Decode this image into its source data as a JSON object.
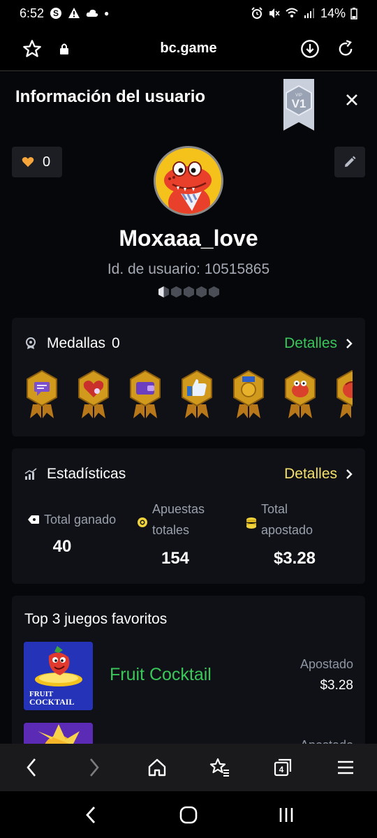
{
  "status_bar": {
    "time": "6:52",
    "battery": "14%"
  },
  "browser": {
    "url": "bc.game",
    "tabs_count": "4"
  },
  "modal": {
    "title": "Información del usuario",
    "vip_label": "V1",
    "vip_small": "VIP"
  },
  "profile": {
    "likes": "0",
    "username": "Moxaaa_love",
    "user_id": "Id. de usuario: 10515865"
  },
  "medals": {
    "title": "Medallas",
    "count": "0",
    "details": "Detalles",
    "items": [
      "chat-medal-icon",
      "heart-medal-icon",
      "wallet-medal-icon",
      "thumbs-up-medal-icon",
      "coin-medal-icon",
      "dino-medal-icon",
      "dino-medal-icon-2"
    ]
  },
  "stats": {
    "title": "Estadísticas",
    "details": "Detalles",
    "total_won_label": "Total ganado",
    "total_won_value": "40",
    "total_bets_label_1": "Apuestas",
    "total_bets_label_2": "totales",
    "total_bets_value": "154",
    "total_wagered_label_1": "Total",
    "total_wagered_label_2": "apostado",
    "total_wagered_value": "$3.28"
  },
  "favorites": {
    "title": "Top 3 juegos favoritos",
    "games": [
      {
        "name": "Fruit Cocktail",
        "bet_label": "Apostado",
        "bet_value": "$3.28",
        "thumb_line1": "FRUIT",
        "thumb_line2": "COCKTAIL"
      },
      {
        "name": "",
        "bet_label": "Apostado",
        "bet_value": ""
      }
    ]
  },
  "colors": {
    "accent_green": "#3bc65a",
    "details_yellow": "#f5e06b",
    "medal_gold": "#d19a1c",
    "background": "#06070b",
    "card": "#0f1117"
  }
}
